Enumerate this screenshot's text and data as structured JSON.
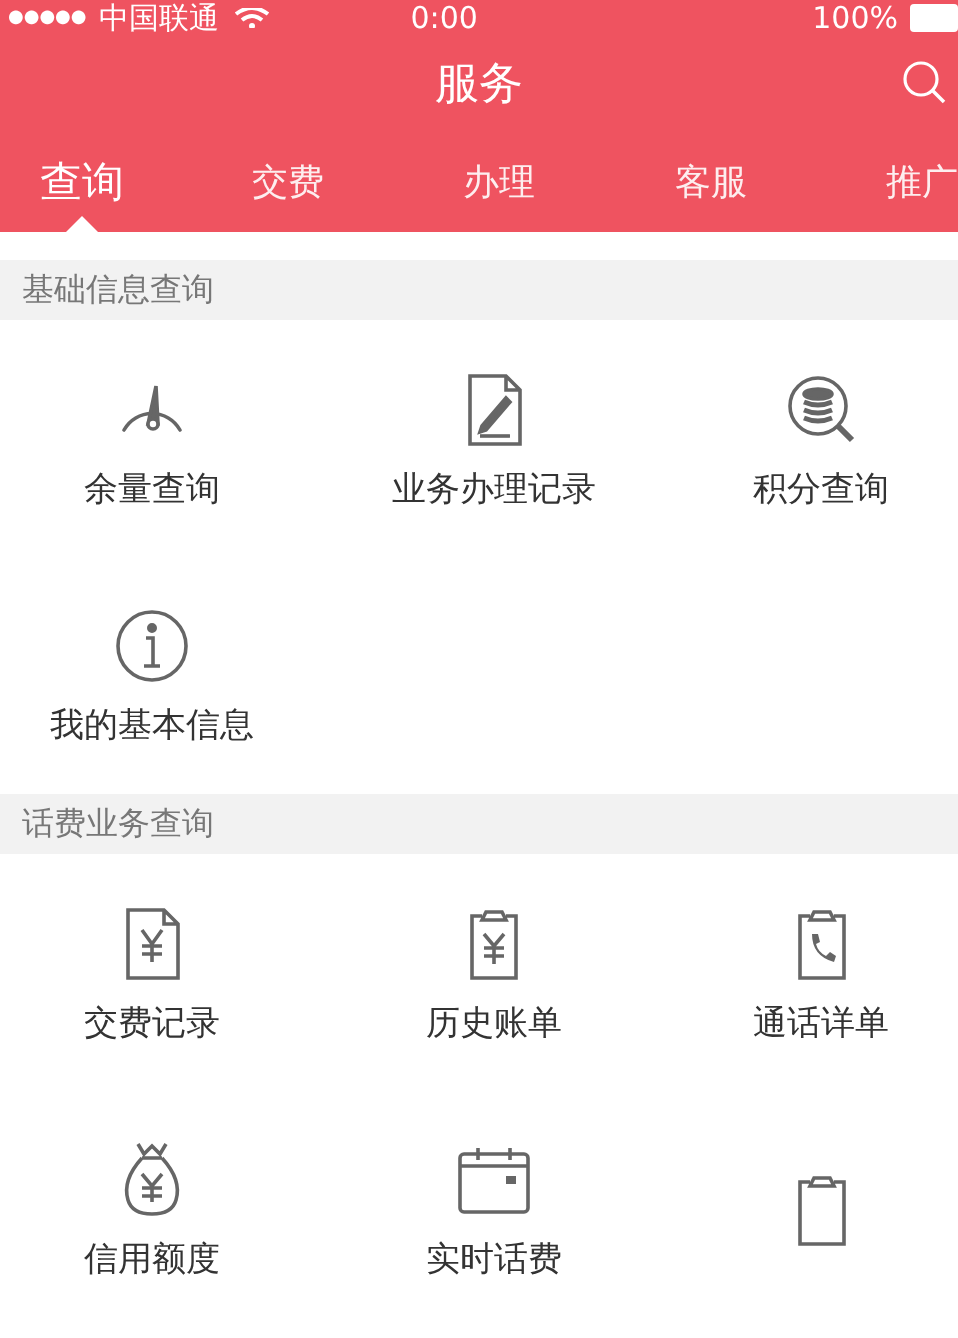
{
  "status_bar": {
    "signal_dots": "●●●●●",
    "carrier": "中国联通",
    "time": "0:00",
    "battery": "100%"
  },
  "header": {
    "title": "服务"
  },
  "tabs": [
    {
      "label": "查询",
      "selected": true
    },
    {
      "label": "交费",
      "selected": false
    },
    {
      "label": "办理",
      "selected": false
    },
    {
      "label": "客服",
      "selected": false
    },
    {
      "label": "推广",
      "selected": false
    }
  ],
  "sections": [
    {
      "title": "基础信息查询",
      "items": [
        {
          "kind": "gauge",
          "label": "余量查询"
        },
        {
          "kind": "document-pen",
          "label": "业务办理记录"
        },
        {
          "kind": "database-search",
          "label": "积分查询"
        },
        {
          "kind": "info",
          "label": "我的基本信息"
        }
      ]
    },
    {
      "title": "话费业务查询",
      "items": [
        {
          "kind": "document-yen",
          "label": "交费记录"
        },
        {
          "kind": "clipboard-yen",
          "label": "历史账单"
        },
        {
          "kind": "clipboard-phone",
          "label": "通话详单"
        },
        {
          "kind": "moneybag",
          "label": "信用额度"
        },
        {
          "kind": "calendar",
          "label": "实时话费"
        },
        {
          "kind": "clipboard"
        }
      ]
    }
  ]
}
